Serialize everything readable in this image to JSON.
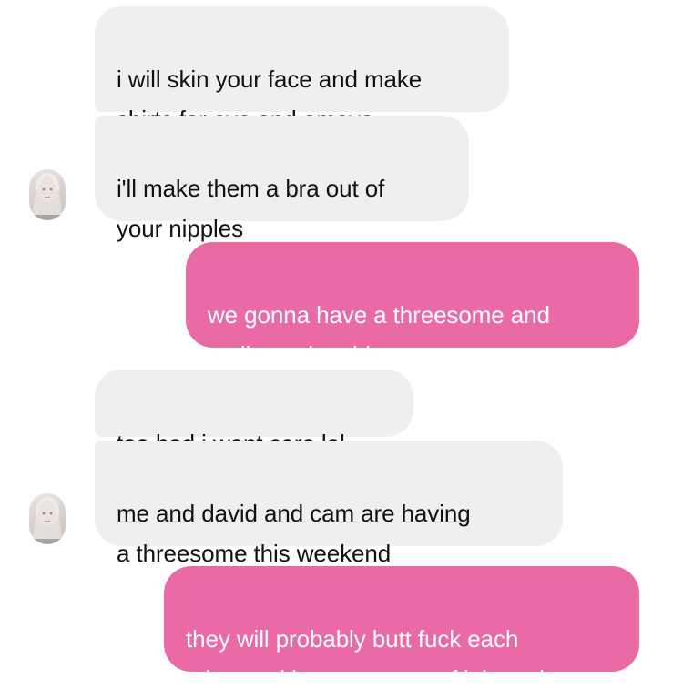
{
  "colors": {
    "incoming_bubble": "#efefef",
    "outgoing_bubble": "#ea6aa6",
    "incoming_text": "#111111",
    "outgoing_text": "#ffffff"
  },
  "messages": [
    {
      "sender": "them",
      "text": "i will skin your face and make\nshirts for eve and amaya"
    },
    {
      "sender": "them",
      "text": "i'll make them a bra out of\nyour nipples"
    },
    {
      "sender": "me",
      "text": "we gonna have a threesome and\nmail you the video"
    },
    {
      "sender": "them",
      "text": "too bad i wont care lol"
    },
    {
      "sender": "them",
      "text": "me and david and cam are having\na threesome this weekend"
    },
    {
      "sender": "me",
      "text": "they will probably butt fuck each\nother and leave you out of it looool"
    }
  ],
  "avatars": [
    {
      "icon": "profile-photo-avatar"
    },
    {
      "icon": "profile-photo-avatar"
    }
  ]
}
